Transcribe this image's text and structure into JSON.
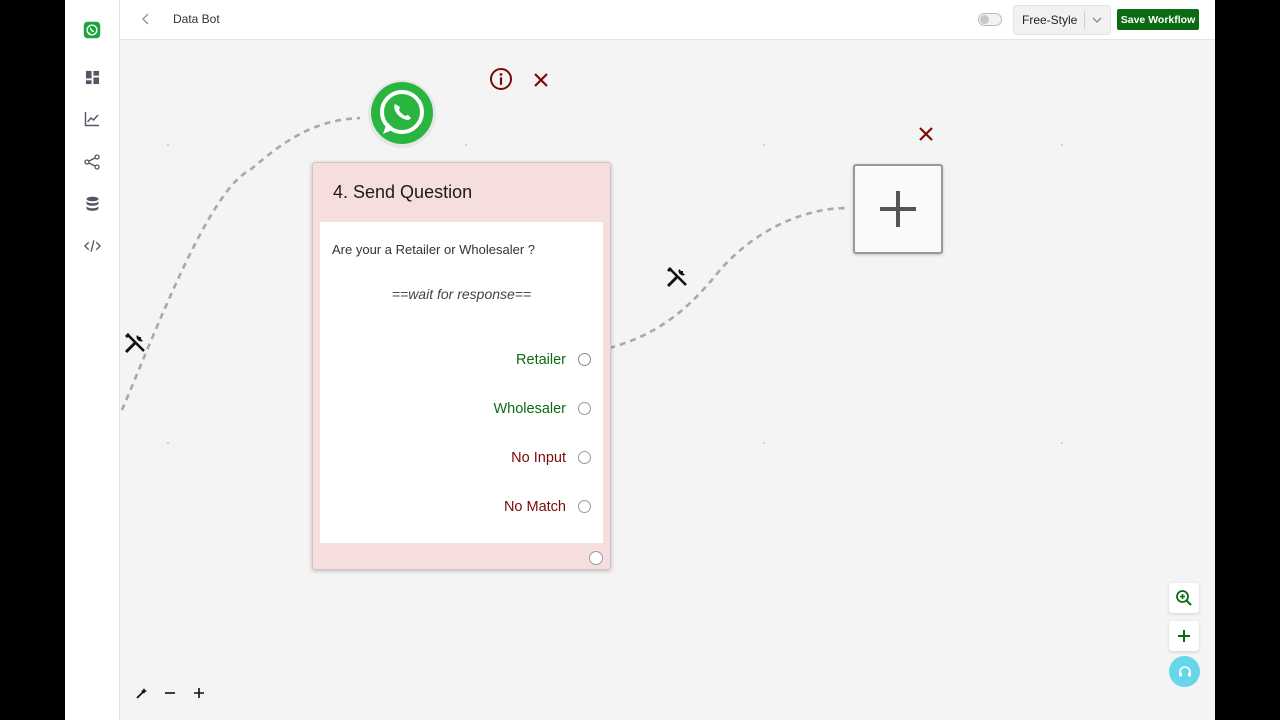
{
  "app": {
    "title": "Data Bot"
  },
  "header": {
    "mode_label": "Free-Style",
    "save_label": "Save Workflow"
  },
  "node": {
    "title": "4. Send Question",
    "question": "Are your a Retailer or Wholesaler ?",
    "wait_text": "==wait for response==",
    "options": [
      {
        "label": "Retailer",
        "tone": "green"
      },
      {
        "label": "Wholesaler",
        "tone": "green"
      },
      {
        "label": "No Input",
        "tone": "red"
      },
      {
        "label": "No Match",
        "tone": "red"
      }
    ]
  },
  "icons": {
    "brand": "whatsapp-icon",
    "sidebar": [
      "dashboard-icon",
      "analytics-icon",
      "share-nodes-icon",
      "database-icon",
      "code-icon"
    ],
    "edge_tools": "wrench-screwdriver-icon",
    "node_info": "info-icon",
    "node_delete": "close-icon"
  },
  "colors": {
    "brand_green": "#0b6b12",
    "danger_red": "#7a0a0a",
    "node_bg": "#f7dede",
    "chat_fab": "#67d6ea"
  }
}
